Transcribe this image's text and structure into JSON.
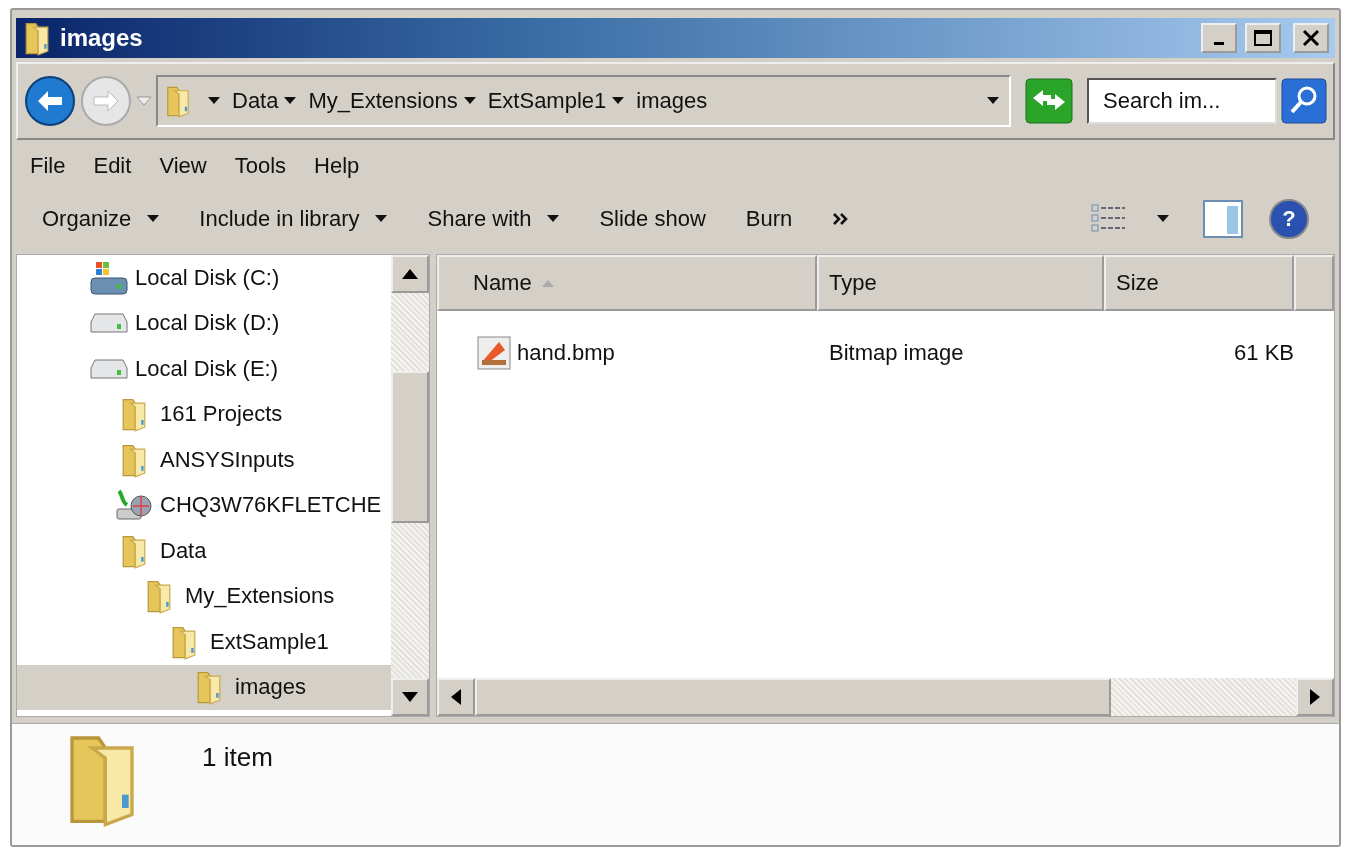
{
  "window": {
    "title": "images"
  },
  "address": {
    "segments": [
      "Data",
      "My_Extensions",
      "ExtSample1",
      "images"
    ]
  },
  "search": {
    "placeholder": "Search im..."
  },
  "menu": [
    "File",
    "Edit",
    "View",
    "Tools",
    "Help"
  ],
  "toolbar": [
    {
      "label": "Organize",
      "dropdown": true
    },
    {
      "label": "Include in library",
      "dropdown": true
    },
    {
      "label": "Share with",
      "dropdown": true
    },
    {
      "label": "Slide show",
      "dropdown": false
    },
    {
      "label": "Burn",
      "dropdown": false
    }
  ],
  "tree": [
    {
      "label": "Local Disk (C:)",
      "kind": "system-drive",
      "selected": false
    },
    {
      "label": "Local Disk (D:)",
      "kind": "drive",
      "selected": false
    },
    {
      "label": "Local Disk (E:)",
      "kind": "drive",
      "selected": false,
      "children": [
        {
          "label": "161 Projects",
          "kind": "folder",
          "selected": false
        },
        {
          "label": "ANSYSInputs",
          "kind": "folder",
          "selected": false
        },
        {
          "label": "CHQ3W76KFLETCHE",
          "kind": "network",
          "selected": false
        },
        {
          "label": "Data",
          "kind": "folder",
          "selected": false,
          "children": [
            {
              "label": "My_Extensions",
              "kind": "folder",
              "selected": false,
              "children": [
                {
                  "label": "ExtSample1",
                  "kind": "folder",
                  "selected": false,
                  "children": [
                    {
                      "label": "images",
                      "kind": "folder",
                      "selected": true
                    }
                  ]
                }
              ]
            }
          ]
        }
      ]
    }
  ],
  "table": {
    "columns": [
      {
        "label": "Name",
        "sorted": true
      },
      {
        "label": "Type",
        "sorted": false
      },
      {
        "label": "Size",
        "sorted": false
      }
    ],
    "rows": [
      {
        "name": "hand.bmp",
        "type": "Bitmap image",
        "size": "61 KB"
      }
    ]
  },
  "help": {
    "label": "?"
  },
  "details": {
    "summary": "1 item"
  }
}
